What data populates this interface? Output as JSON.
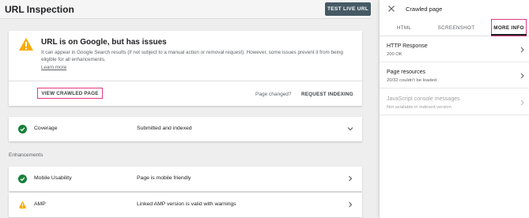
{
  "header": {
    "title": "URL Inspection",
    "test_live_button": "TEST LIVE URL"
  },
  "main_card": {
    "title": "URL is on Google, but has issues",
    "description": "It can appear in Google Search results (if not subject to a manual action or removal request). However, some issues prevent it from being eligible for all enhancements.",
    "learn_more": "Learn more",
    "view_crawled": "VIEW CRAWLED PAGE",
    "page_changed": "Page changed?",
    "request_indexing": "REQUEST INDEXING"
  },
  "coverage": {
    "label": "Coverage",
    "value": "Submitted and indexed"
  },
  "enhancements": {
    "heading": "Enhancements",
    "items": [
      {
        "label": "Mobile Usability",
        "value": "Page is mobile friendly"
      },
      {
        "label": "AMP",
        "value": "Linked AMP version is valid with warnings"
      }
    ]
  },
  "side_panel": {
    "title": "Crawled page",
    "tabs": [
      "HTML",
      "SCREENSHOT",
      "MORE INFO"
    ],
    "items": [
      {
        "label": "HTTP Response",
        "sub": "200 OK"
      },
      {
        "label": "Page resources",
        "sub": "20/32 couldn't be loaded"
      },
      {
        "label": "JavaScript console messages",
        "sub": "Not available in indexed version"
      }
    ]
  },
  "colors": {
    "accent_highlight": "#e53880",
    "success": "#188038",
    "warning": "#f9ab00",
    "button_dark": "#455a64"
  }
}
